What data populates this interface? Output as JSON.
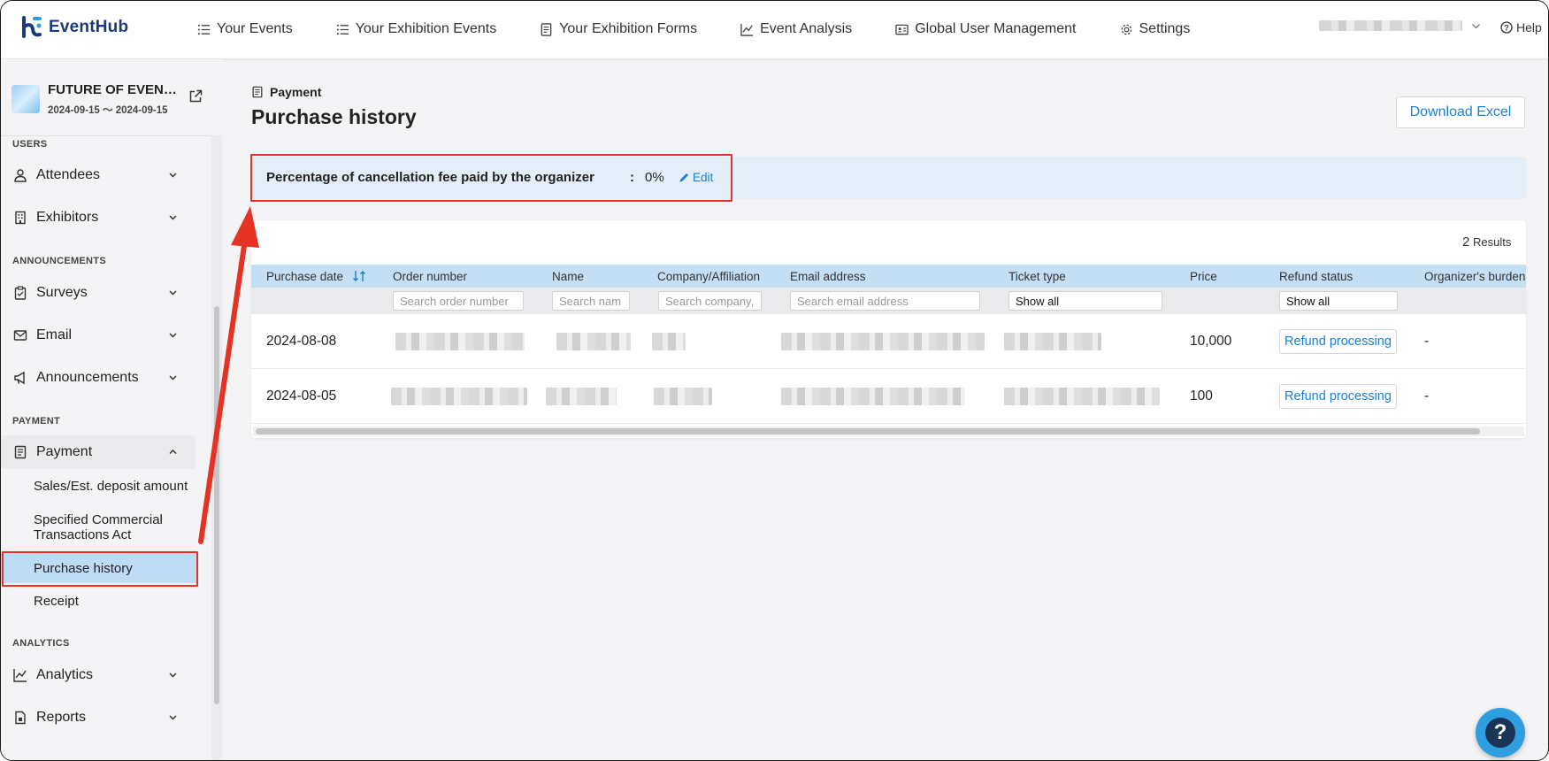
{
  "app": {
    "logo_text": "EventHub",
    "brand_color": "#1c3a7a",
    "accent_color": "#1a7fd6",
    "highlight_color": "#e53222"
  },
  "topnav": {
    "items": [
      {
        "label": "Your Events",
        "icon": "list-icon"
      },
      {
        "label": "Your Exhibition Events",
        "icon": "list-icon"
      },
      {
        "label": "Your Exhibition Forms",
        "icon": "form-icon"
      },
      {
        "label": "Event Analysis",
        "icon": "chart-icon"
      },
      {
        "label": "Global User Management",
        "icon": "id-card-icon"
      },
      {
        "label": "Settings",
        "icon": "gear-icon"
      }
    ],
    "help_label": "Help"
  },
  "sidebar": {
    "event_name": "FUTURE OF EVEN…",
    "event_dates": "2024-09-15 〜 2024-09-15",
    "sections": {
      "users": "USERS",
      "announcements": "ANNOUNCEMENTS",
      "payment": "PAYMENT",
      "analytics": "ANALYTICS"
    },
    "items": {
      "attendees": "Attendees",
      "exhibitors": "Exhibitors",
      "surveys": "Surveys",
      "email": "Email",
      "announcements": "Announcements",
      "payment": "Payment",
      "analytics": "Analytics",
      "reports": "Reports"
    },
    "payment_sub": {
      "sales": "Sales/Est. deposit amount",
      "commercial_line1": "Specified Commercial",
      "commercial_line2": "Transactions Act",
      "purchase_history": "Purchase history",
      "receipt": "Receipt"
    }
  },
  "main": {
    "breadcrumb": "Payment",
    "title": "Purchase history",
    "download_label": "Download Excel",
    "fee": {
      "label": "Percentage of cancellation fee paid by the organizer",
      "colon": ":",
      "value": "0%",
      "edit_label": "Edit"
    },
    "results_count": "2",
    "results_label": "Results",
    "columns": {
      "purchase_date": "Purchase date",
      "order_number": "Order number",
      "name": "Name",
      "company": "Company/Affiliation",
      "email": "Email address",
      "ticket_type": "Ticket type",
      "price": "Price",
      "refund_status": "Refund status",
      "organizer_burden": "Organizer's burden"
    },
    "filters": {
      "order_number_placeholder": "Search order number",
      "name_placeholder": "Search nam",
      "company_placeholder": "Search company,",
      "email_placeholder": "Search email address",
      "ticket_type_value": "Show all",
      "refund_status_value": "Show all"
    },
    "rows": [
      {
        "purchase_date": "2024-08-08",
        "price": "10,000",
        "refund_status": "Refund processing",
        "organizer_burden": "-"
      },
      {
        "purchase_date": "2024-08-05",
        "price": "100",
        "refund_status": "Refund processing",
        "organizer_burden": "-"
      }
    ]
  }
}
